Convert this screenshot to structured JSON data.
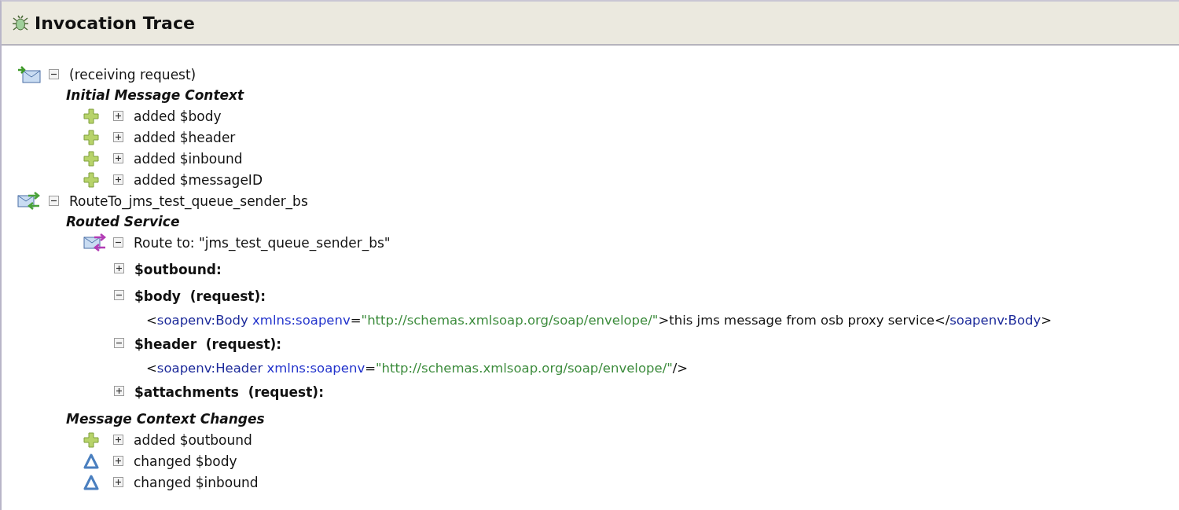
{
  "window": {
    "title": "Invocation Trace"
  },
  "tree": [
    {
      "kind": "receive",
      "expanded": true,
      "label": "(receiving request)",
      "sections": [
        {
          "heading": "Initial Message Context",
          "items": [
            {
              "kind": "added",
              "expanded": false,
              "label": "added $body"
            },
            {
              "kind": "added",
              "expanded": false,
              "label": "added $header"
            },
            {
              "kind": "added",
              "expanded": false,
              "label": "added $inbound"
            },
            {
              "kind": "added",
              "expanded": false,
              "label": "added $messageID"
            }
          ]
        }
      ]
    },
    {
      "kind": "route",
      "expanded": true,
      "label": "RouteTo_jms_test_queue_sender_bs",
      "sections": [
        {
          "heading": "Routed Service",
          "items": [
            {
              "kind": "route-to",
              "expanded": true,
              "label": "Route to: \"jms_test_queue_sender_bs\"",
              "children": [
                {
                  "kind": "variable",
                  "expanded": false,
                  "label": "$outbound:"
                },
                {
                  "kind": "variable",
                  "expanded": true,
                  "label": "$body  (request):",
                  "xml": [
                    {
                      "kind": "punct",
                      "text": "<"
                    },
                    {
                      "kind": "tag",
                      "text": "soapenv:Body"
                    },
                    {
                      "kind": "attr",
                      "text": " xmlns:soapenv"
                    },
                    {
                      "kind": "punct",
                      "text": "="
                    },
                    {
                      "kind": "value",
                      "text": "\"http://schemas.xmlsoap.org/soap/envelope/\""
                    },
                    {
                      "kind": "punct",
                      "text": ">this jms message from osb proxy service</"
                    },
                    {
                      "kind": "tag",
                      "text": "soapenv:Body"
                    },
                    {
                      "kind": "punct",
                      "text": ">"
                    }
                  ]
                },
                {
                  "kind": "variable",
                  "expanded": true,
                  "label": "$header  (request):",
                  "xml": [
                    {
                      "kind": "punct",
                      "text": "<"
                    },
                    {
                      "kind": "tag",
                      "text": "soapenv:Header"
                    },
                    {
                      "kind": "attr",
                      "text": " xmlns:soapenv"
                    },
                    {
                      "kind": "punct",
                      "text": "="
                    },
                    {
                      "kind": "value",
                      "text": "\"http://schemas.xmlsoap.org/soap/envelope/\""
                    },
                    {
                      "kind": "punct",
                      "text": "/>"
                    }
                  ]
                },
                {
                  "kind": "variable",
                  "expanded": false,
                  "label": "$attachments  (request):"
                }
              ]
            }
          ]
        },
        {
          "heading": "Message Context Changes",
          "items": [
            {
              "kind": "added",
              "expanded": false,
              "label": "added $outbound"
            },
            {
              "kind": "changed",
              "expanded": false,
              "label": "changed $body"
            },
            {
              "kind": "changed",
              "expanded": false,
              "label": "changed $inbound"
            }
          ]
        }
      ]
    }
  ]
}
